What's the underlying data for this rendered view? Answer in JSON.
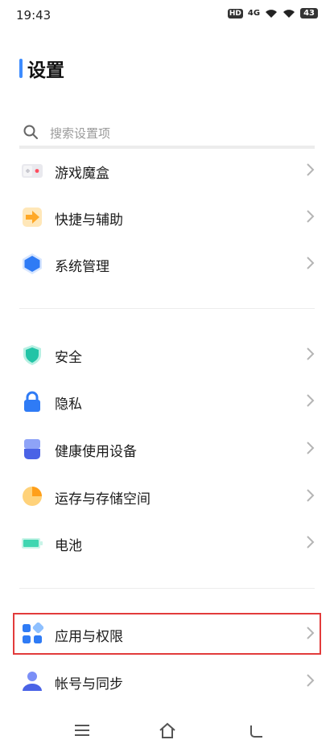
{
  "status_bar": {
    "time": "19:43",
    "hd_label": "HD",
    "network_label": "4G",
    "battery_label": "43"
  },
  "header": {
    "title": "设置"
  },
  "search": {
    "placeholder": "搜索设置项"
  },
  "groups": [
    {
      "items": [
        {
          "label": "游戏魔盒",
          "icon": "game-box-icon"
        },
        {
          "label": "快捷与辅助",
          "icon": "shortcut-icon"
        },
        {
          "label": "系统管理",
          "icon": "system-hexagon-icon"
        }
      ]
    },
    {
      "items": [
        {
          "label": "安全",
          "icon": "shield-icon"
        },
        {
          "label": "隐私",
          "icon": "lock-icon"
        },
        {
          "label": "健康使用设备",
          "icon": "health-icon"
        },
        {
          "label": "运存与存储空间",
          "icon": "storage-pie-icon"
        },
        {
          "label": "电池",
          "icon": "battery-icon"
        }
      ]
    },
    {
      "items": [
        {
          "label": "应用与权限",
          "icon": "apps-grid-icon",
          "highlighted": true
        },
        {
          "label": "帐号与同步",
          "icon": "account-icon"
        }
      ]
    }
  ],
  "colors": {
    "accent": "#3d8cff",
    "highlight_border": "#e23b3b",
    "shortcut_orange": "#ffa826",
    "system_blue": "#2f7bf5",
    "security_green": "#22c4a6",
    "battery_green": "#3fd6b1"
  }
}
